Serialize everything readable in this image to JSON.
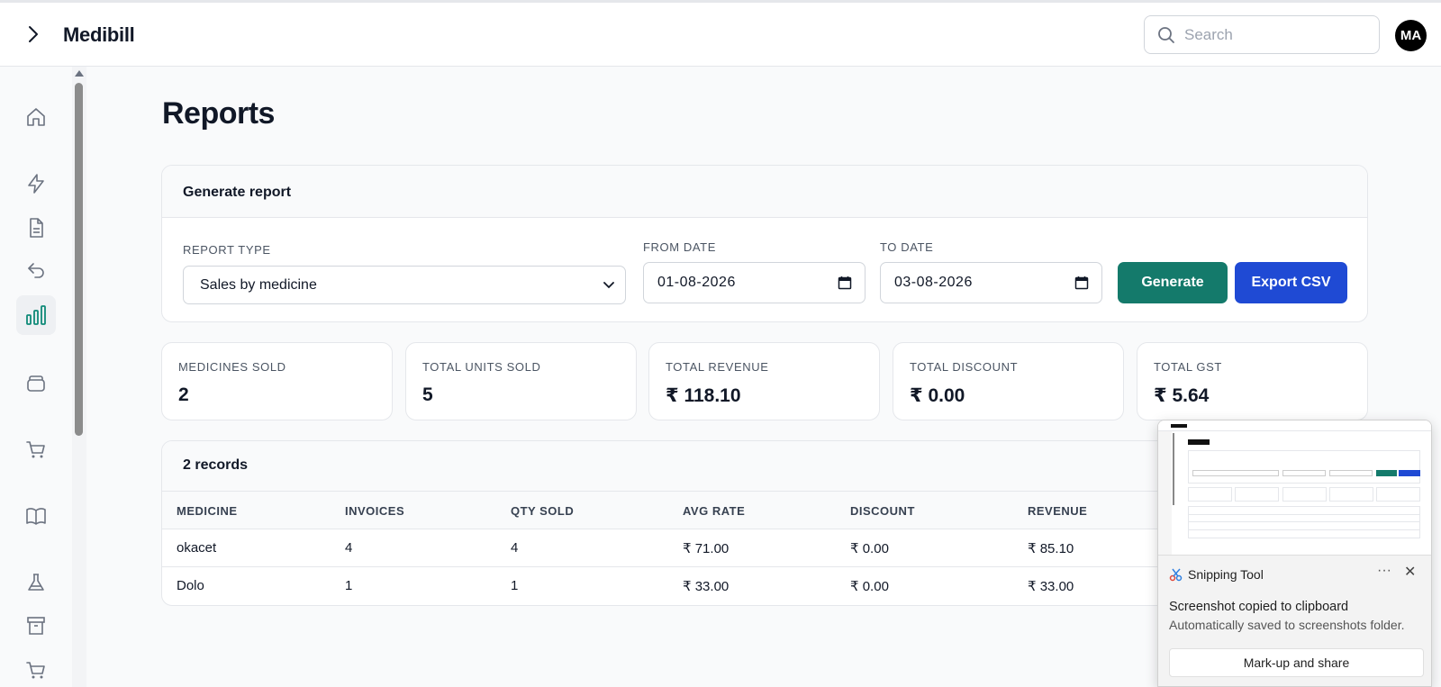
{
  "header": {
    "brand": "Medibill",
    "search_placeholder": "Search",
    "avatar_initials": "MA"
  },
  "sidebar": {
    "items": [
      {
        "icon": "home-icon",
        "active": false
      },
      {
        "icon": "lightning-icon",
        "active": false
      },
      {
        "icon": "document-icon",
        "active": false
      },
      {
        "icon": "return-arrow-icon",
        "active": false
      },
      {
        "icon": "bar-chart-icon",
        "active": true
      },
      {
        "icon": "layers-icon",
        "active": false
      },
      {
        "icon": "cart-icon",
        "active": false
      },
      {
        "icon": "book-icon",
        "active": false
      },
      {
        "icon": "flask-icon",
        "active": false
      },
      {
        "icon": "archive-icon",
        "active": false
      },
      {
        "icon": "cart-icon",
        "active": false
      }
    ]
  },
  "page": {
    "title": "Reports"
  },
  "generate": {
    "heading": "Generate report",
    "report_type_label": "REPORT TYPE",
    "report_type_value": "Sales by medicine",
    "from_label": "FROM DATE",
    "from_value": "01-08-2026",
    "to_label": "TO DATE",
    "to_value": "03-08-2026",
    "generate_label": "Generate",
    "export_label": "Export CSV"
  },
  "stats": [
    {
      "label": "MEDICINES SOLD",
      "value": "2"
    },
    {
      "label": "TOTAL UNITS SOLD",
      "value": "5"
    },
    {
      "label": "TOTAL REVENUE",
      "value": "₹ 118.10"
    },
    {
      "label": "TOTAL DISCOUNT",
      "value": "₹ 0.00"
    },
    {
      "label": "TOTAL GST",
      "value": "₹ 5.64"
    }
  ],
  "records": {
    "count_label": "2 records",
    "columns": [
      "MEDICINE",
      "INVOICES",
      "QTY SOLD",
      "AVG RATE",
      "DISCOUNT",
      "REVENUE"
    ],
    "rows": [
      [
        "okacet",
        "4",
        "4",
        "₹ 71.00",
        "₹ 0.00",
        "₹ 85.10"
      ],
      [
        "Dolo",
        "1",
        "1",
        "₹ 33.00",
        "₹ 0.00",
        "₹ 33.00"
      ]
    ]
  },
  "snipping_tool": {
    "app_name": "Snipping Tool",
    "message": "Screenshot copied to clipboard",
    "sub_message": "Automatically saved to screenshots folder.",
    "action_label": "Mark-up and share",
    "more_label": "···",
    "close_label": "✕"
  },
  "colors": {
    "accent_teal": "#147a6b",
    "accent_blue": "#1f4ad4",
    "sidebar_active_icon": "#0f8a78"
  }
}
